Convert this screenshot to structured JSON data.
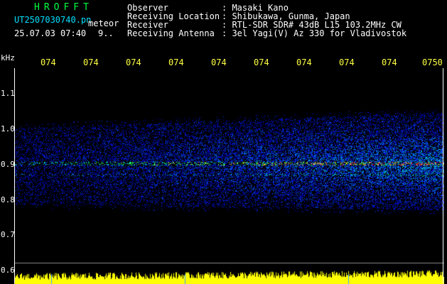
{
  "header": {
    "logo": "HROFFT",
    "filename": "UT2507030740.pn",
    "mode": "meteor",
    "datetime": "25.07.03 07:40",
    "count": "9..",
    "labels": [
      "Observer",
      "Receiving Location",
      "Receiver",
      "Receiving Antenna"
    ],
    "values": [
      ": Masaki Kano",
      ": Shibukawa, Gunma, Japan",
      ": RTL-SDR SDR# 43dB L15 103.2MHz CW",
      ": 3el Yagi(V) Az 330 for Vladivostok"
    ]
  },
  "axis": {
    "unit": "kHz",
    "time_ticks": [
      "074",
      "074",
      "074",
      "074",
      "074",
      "074",
      "074",
      "074",
      "074",
      "0750"
    ],
    "freq_ticks": [
      "1.1",
      "1.0",
      "0.9",
      "0.8",
      "0.7",
      "0.6"
    ]
  },
  "colors": {
    "background": "#000000",
    "logo": "#00ff40",
    "filename": "#00e0ff",
    "ticks": "#ffff40",
    "noise": "#ffff00",
    "signal_hot": "#ff3060"
  }
}
